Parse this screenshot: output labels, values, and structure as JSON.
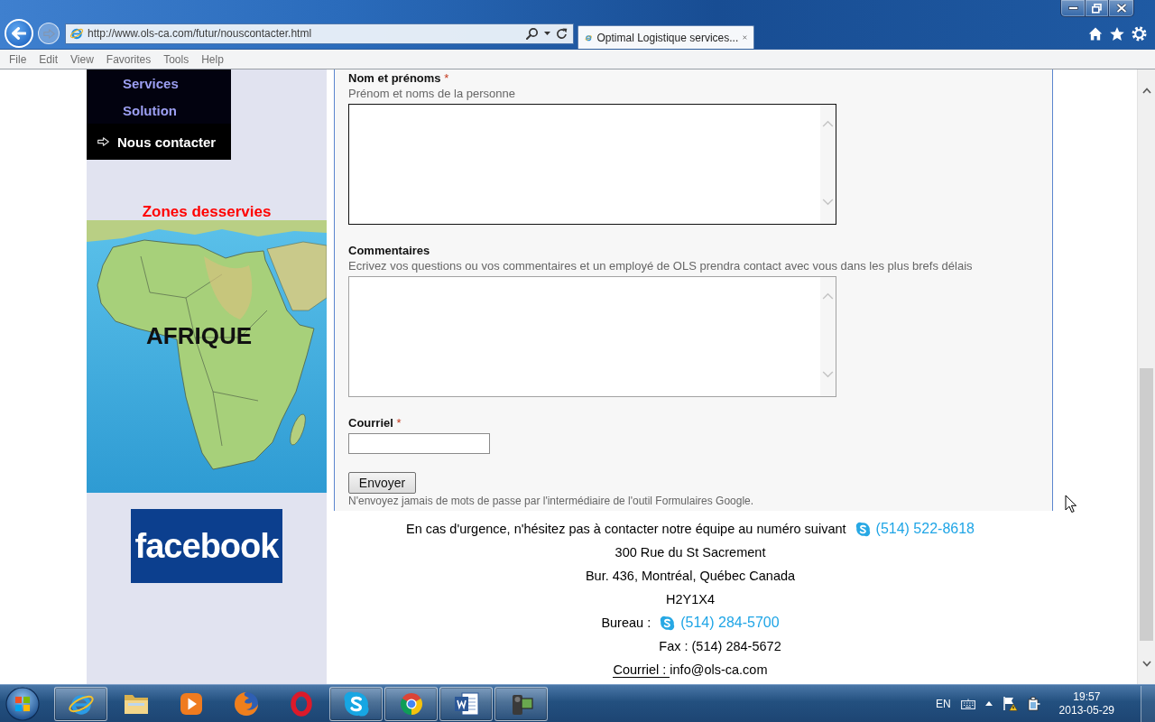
{
  "browser": {
    "nav_buttons": [
      {
        "kind": "back",
        "disabled": false
      },
      {
        "kind": "forward",
        "disabled": true
      }
    ],
    "address": "http://www.ols-ca.com/futur/nouscontacter.html",
    "tabs": [
      {
        "title": "Optimal Logistique services...",
        "selected": true
      }
    ]
  },
  "menu_bar": [
    "File",
    "Edit",
    "View",
    "Favorites",
    "Tools",
    "Help"
  ],
  "sidebar": {
    "nav_items": [
      {
        "label": "Services",
        "selected": false
      },
      {
        "label": "Solution",
        "selected": false
      },
      {
        "label": "Nous contacter",
        "selected": true
      }
    ],
    "zones_title": "Zones desservies",
    "map_label": "AFRIQUE",
    "logo_text": "facebook"
  },
  "form": {
    "fields": [
      {
        "kind": "textarea",
        "label": "Nom et prénoms",
        "required_mark": "*",
        "help": "Prénom et noms de la personne",
        "focused": true
      },
      {
        "kind": "textarea",
        "label": "Commentaires",
        "help": "Ecrivez vos questions ou vos commentaires et un employé de OLS prendra contact avec vous dans les plus brefs délais",
        "focused": false
      },
      {
        "kind": "text",
        "label": "Courriel",
        "required_mark": "*",
        "focused": false
      }
    ],
    "submit": "Envoyer",
    "note": "N'envoyez jamais de mots de passe par l'intermédiaire de l'outil Formulaires Google."
  },
  "footer": {
    "lines": [
      {
        "kind": "phone",
        "text": "En cas d'urgence, n'hésitez pas à contacter notre équipe au numéro suivant",
        "phone": "(514) 522-8618"
      },
      {
        "kind": "plain",
        "text": "300 Rue du St Sacrement"
      },
      {
        "kind": "plain",
        "text": "Bur. 436, Montréal, Québec Canada"
      },
      {
        "kind": "plain",
        "text": "H2Y1X4"
      },
      {
        "kind": "phone",
        "text": "Bureau :",
        "phone": "(514) 284-5700"
      },
      {
        "kind": "offset",
        "text": "Fax : (514) 284-5672"
      },
      {
        "kind": "email",
        "label": "Courriel :",
        "text": "info@ols-ca.com"
      }
    ]
  },
  "taskbar": {
    "apps": [
      {
        "kind": "ie",
        "running": true
      },
      {
        "kind": "explorer",
        "running": false
      },
      {
        "kind": "media",
        "running": false
      },
      {
        "kind": "firefox",
        "running": false
      },
      {
        "kind": "opera",
        "running": false
      },
      {
        "kind": "skype",
        "running": true
      },
      {
        "kind": "chrome",
        "running": true
      },
      {
        "kind": "word",
        "running": true
      },
      {
        "kind": "camcorder",
        "running": true
      }
    ],
    "tray": {
      "language": "EN",
      "time": "19:57",
      "date": "2013-05-29"
    }
  }
}
